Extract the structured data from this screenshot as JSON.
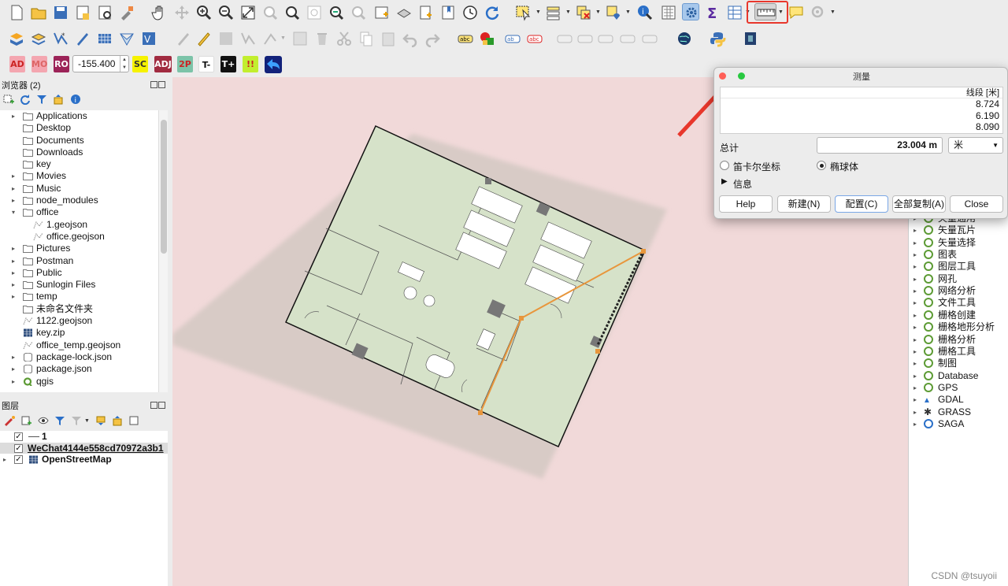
{
  "toolbar": {
    "coord_value": "-155.400",
    "pills": [
      "AD",
      "MO",
      "RO",
      "SC",
      "ADJ",
      "2P",
      "T-",
      "T+",
      "!!"
    ]
  },
  "browser": {
    "title": "浏览器 (2)",
    "items": [
      {
        "label": "Applications",
        "icon": "folder",
        "arrow": "▸"
      },
      {
        "label": "Desktop",
        "icon": "folder",
        "arrow": ""
      },
      {
        "label": "Documents",
        "icon": "folder",
        "arrow": ""
      },
      {
        "label": "Downloads",
        "icon": "folder",
        "arrow": ""
      },
      {
        "label": "key",
        "icon": "folder",
        "arrow": ""
      },
      {
        "label": "Movies",
        "icon": "folder",
        "arrow": "▸"
      },
      {
        "label": "Music",
        "icon": "folder",
        "arrow": "▸"
      },
      {
        "label": "node_modules",
        "icon": "folder",
        "arrow": "▸"
      },
      {
        "label": "office",
        "icon": "folder",
        "arrow": "▾"
      },
      {
        "label": "1.geojson",
        "icon": "vector",
        "arrow": "",
        "indent": true
      },
      {
        "label": "office.geojson",
        "icon": "vector",
        "arrow": "",
        "indent": true
      },
      {
        "label": "Pictures",
        "icon": "folder",
        "arrow": "▸"
      },
      {
        "label": "Postman",
        "icon": "folder",
        "arrow": "▸"
      },
      {
        "label": "Public",
        "icon": "folder",
        "arrow": "▸"
      },
      {
        "label": "Sunlogin Files",
        "icon": "folder",
        "arrow": "▸"
      },
      {
        "label": "temp",
        "icon": "folder",
        "arrow": "▸"
      },
      {
        "label": "未命名文件夹",
        "icon": "folder",
        "arrow": ""
      },
      {
        "label": "1122.geojson",
        "icon": "vector",
        "arrow": ""
      },
      {
        "label": "key.zip",
        "icon": "raster",
        "arrow": ""
      },
      {
        "label": "office_temp.geojson",
        "icon": "vector",
        "arrow": ""
      },
      {
        "label": "package-lock.json",
        "icon": "db",
        "arrow": "▸"
      },
      {
        "label": "package.json",
        "icon": "db",
        "arrow": "▸"
      },
      {
        "label": "qgis",
        "icon": "qgis",
        "arrow": "▸"
      }
    ]
  },
  "layers": {
    "title": "图层",
    "items": [
      {
        "label": "1",
        "checked": true,
        "bold": true
      },
      {
        "label": "WeChat4144e558cd70972a3b1",
        "checked": true,
        "bold": true
      },
      {
        "label": "OpenStreetMap",
        "checked": true,
        "bold": true
      }
    ]
  },
  "processing": {
    "items": [
      "矢量通用",
      "矢量瓦片",
      "矢量选择",
      "图表",
      "图层工具",
      "网孔",
      "网络分析",
      "文件工具",
      "栅格创建",
      "栅格地形分析",
      "栅格分析",
      "栅格工具",
      "制图",
      "Database",
      "GPS",
      "GDAL",
      "GRASS",
      "SAGA"
    ]
  },
  "measure": {
    "title": "测量",
    "column_header": "线段 [米]",
    "segments": [
      "8.724",
      "6.190",
      "8.090"
    ],
    "total_label": "总计",
    "total_value": "23.004 m",
    "unit": "米",
    "cartesian_label": "笛卡尔坐标",
    "ellipsoid_label": "椭球体",
    "info_label": "信息",
    "buttons": {
      "help": "Help",
      "new": "新建(N)",
      "config": "配置(C)",
      "copy_all": "全部复制(A)",
      "close": "Close"
    }
  },
  "watermark": "CSDN @tsuyoii",
  "colors": {
    "accent_red": "#e8372c",
    "map_bg": "#f1d9d9",
    "plan_fill": "#d6e2c9",
    "qgis_green": "#5d9b35"
  }
}
